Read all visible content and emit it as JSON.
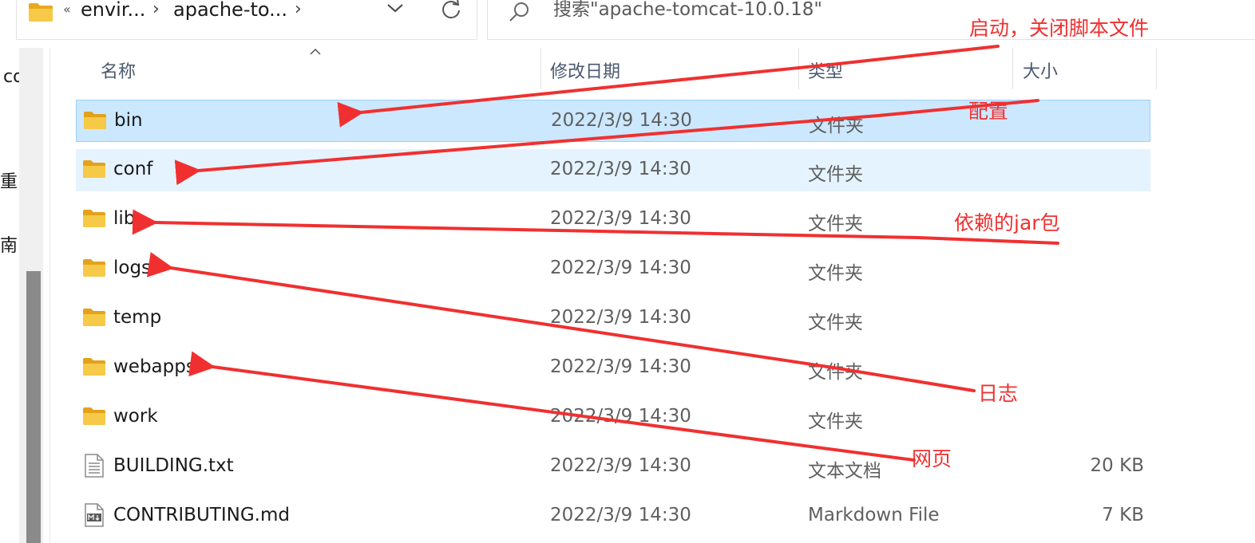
{
  "address_bar": {
    "overflow_glyph": "«",
    "crumbs": [
      "envir...",
      "apache-to..."
    ]
  },
  "search": {
    "placeholder": "搜索\"apache-tomcat-10.0.18\""
  },
  "nav_fragments": [
    "co",
    "和重",
    "南"
  ],
  "columns": {
    "name": "名称",
    "modified": "修改日期",
    "type": "类型",
    "size": "大小"
  },
  "files": [
    {
      "name": "bin",
      "modified": "2022/3/9 14:30",
      "type": "文件夹",
      "size": "",
      "icon": "folder-icon",
      "state": "selected"
    },
    {
      "name": "conf",
      "modified": "2022/3/9 14:30",
      "type": "文件夹",
      "size": "",
      "icon": "folder-icon",
      "state": "hover"
    },
    {
      "name": "lib",
      "modified": "2022/3/9 14:30",
      "type": "文件夹",
      "size": "",
      "icon": "folder-icon",
      "state": ""
    },
    {
      "name": "logs",
      "modified": "2022/3/9 14:30",
      "type": "文件夹",
      "size": "",
      "icon": "folder-icon",
      "state": ""
    },
    {
      "name": "temp",
      "modified": "2022/3/9 14:30",
      "type": "文件夹",
      "size": "",
      "icon": "folder-icon",
      "state": ""
    },
    {
      "name": "webapps",
      "modified": "2022/3/9 14:30",
      "type": "文件夹",
      "size": "",
      "icon": "folder-icon",
      "state": ""
    },
    {
      "name": "work",
      "modified": "2022/3/9 14:30",
      "type": "文件夹",
      "size": "",
      "icon": "folder-icon",
      "state": ""
    },
    {
      "name": "BUILDING.txt",
      "modified": "2022/3/9 14:30",
      "type": "文本文档",
      "size": "20 KB",
      "icon": "text-file-icon",
      "state": ""
    },
    {
      "name": "CONTRIBUTING.md",
      "modified": "2022/3/9 14:30",
      "type": "Markdown File",
      "size": "7 KB",
      "icon": "markdown-file-icon",
      "state": ""
    }
  ],
  "annotations": {
    "bin": "启动，关闭脚本文件",
    "conf": "配置",
    "lib": "依赖的jar包",
    "logs": "日志",
    "webapps": "网页"
  },
  "colors": {
    "selected_row": "#cce8ff",
    "hover_row": "#e5f3ff",
    "annotation": "#f03030",
    "folder": "#f5c33b"
  }
}
